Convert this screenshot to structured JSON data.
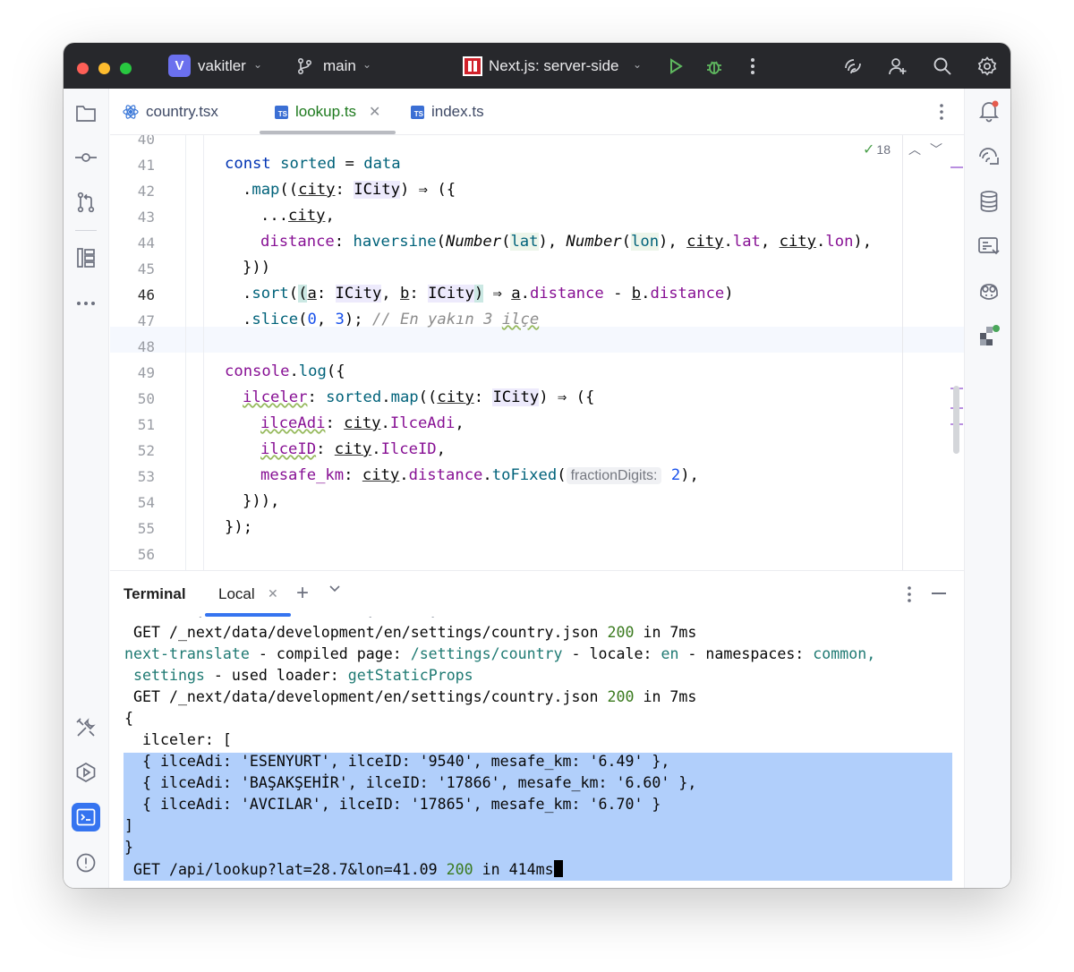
{
  "titlebar": {
    "project_initial": "V",
    "project_name": "vakitler",
    "branch": "main",
    "run_config": "Next.js: server-side"
  },
  "tabs": [
    {
      "label": "country.tsx",
      "icon": "react-icon"
    },
    {
      "label": "lookup.ts",
      "icon": "typescript-icon",
      "active": true
    },
    {
      "label": "index.ts",
      "icon": "typescript-icon"
    }
  ],
  "editor": {
    "inspection_count": "18",
    "line_numbers": [
      "40",
      "41",
      "42",
      "43",
      "44",
      "45",
      "46",
      "47",
      "48",
      "49",
      "50",
      "51",
      "52",
      "53",
      "54",
      "55",
      "56"
    ],
    "current_line": "46",
    "code": {
      "l41": [
        "const",
        " sorted",
        " = ",
        "data"
      ],
      "l42": [
        ".",
        "map",
        "((",
        "city",
        ": ",
        "ICity",
        ") ⇒ ({"
      ],
      "l43": [
        "...",
        "city",
        ","
      ],
      "l44": [
        "distance",
        ": ",
        "haversine",
        "(",
        "Number",
        "(",
        "lat",
        "), ",
        "Number",
        "(",
        "lon",
        "), ",
        "city",
        ".",
        "lat",
        ", ",
        "city",
        ".",
        "lon",
        "),"
      ],
      "l45": [
        "}))"
      ],
      "l46": [
        ".",
        "sort",
        "(",
        "(",
        "a",
        ": ",
        "ICity",
        ", ",
        "b",
        ": ",
        "ICity",
        ")",
        " ⇒ ",
        "a",
        ".",
        "distance",
        " - ",
        "b",
        ".",
        "distance",
        ")"
      ],
      "l47": [
        ".",
        "slice",
        "(",
        "0",
        ", ",
        "3",
        "); ",
        "// En yakın 3 ",
        "ilçe"
      ],
      "l49": [
        "console",
        ".",
        "log",
        "({"
      ],
      "l50": [
        "ilceler",
        ": ",
        "sorted",
        ".",
        "map",
        "((",
        "city",
        ": ",
        "ICity",
        ") ⇒ ({"
      ],
      "l51": [
        "ilceAdi",
        ": ",
        "city",
        ".",
        "IlceAdi",
        ","
      ],
      "l52": [
        "ilceID",
        ": ",
        "city",
        ".",
        "IlceID",
        ","
      ],
      "l53": [
        "mesafe_km",
        ": ",
        "city",
        ".",
        "distance",
        ".",
        "toFixed",
        "(",
        "fractionDigits:",
        " ",
        "2",
        "),"
      ],
      "l54": [
        "})),"
      ],
      "l55": [
        "});"
      ]
    }
  },
  "terminal": {
    "title": "Terminal",
    "tab": "Local",
    "lines": [
      {
        "parts": [
          " GET /_next/data/development/en/settings/country.json ",
          "200",
          " in 7ms"
        ]
      },
      {
        "parts": [
          "next-translate",
          " - compiled page: ",
          "/settings/country",
          " - locale: ",
          "en",
          " - namespaces: ",
          "common,"
        ]
      },
      {
        "parts": [
          " ",
          "settings",
          " - used loader: ",
          "getStaticProps"
        ]
      },
      {
        "parts": [
          " GET /_next/data/development/en/settings/country.json ",
          "200",
          " in 7ms"
        ]
      },
      {
        "parts": [
          "{"
        ]
      },
      {
        "parts": [
          "  ilceler: ["
        ]
      },
      {
        "parts": [
          "  { ilceAdi: 'ESENYURT', ilceID: '9540', mesafe_km: '6.49' },"
        ]
      },
      {
        "parts": [
          "  { ilceAdi: 'BAŞAKŞEHİR', ilceID: '17866', mesafe_km: '6.60' },"
        ]
      },
      {
        "parts": [
          "  { ilceAdi: 'AVCILAR', ilceID: '17865', mesafe_km: '6.70' }"
        ]
      },
      {
        "parts": [
          "]"
        ]
      },
      {
        "parts": [
          "}"
        ]
      },
      {
        "parts": [
          " GET /api/lookup?lat=28.7&lon=41.09 ",
          "200",
          " in 414ms"
        ]
      }
    ]
  },
  "colors": {
    "titlebar_bg": "#27282c",
    "accent": "#3574f0",
    "selection": "#b1cffb",
    "active_tab_text": "#1e7a1e"
  }
}
